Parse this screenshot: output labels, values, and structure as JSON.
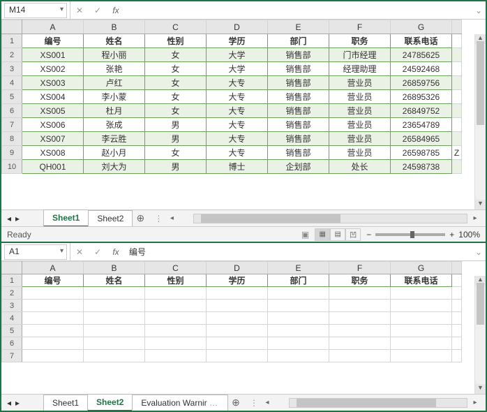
{
  "pane1": {
    "nameBox": "M14",
    "formula": "",
    "columns": [
      "A",
      "B",
      "C",
      "D",
      "E",
      "F",
      "G"
    ],
    "rowNums": [
      "1",
      "2",
      "3",
      "4",
      "5",
      "6",
      "7",
      "8",
      "9",
      "10"
    ],
    "headers": [
      "编号",
      "姓名",
      "性别",
      "学历",
      "部门",
      "职务",
      "联系电话"
    ],
    "rows": [
      [
        "XS001",
        "程小丽",
        "女",
        "大学",
        "销售部",
        "门市经理",
        "24785625",
        ""
      ],
      [
        "XS002",
        "张艳",
        "女",
        "大学",
        "销售部",
        "经理助理",
        "24592468",
        ""
      ],
      [
        "XS003",
        "卢红",
        "女",
        "大专",
        "销售部",
        "营业员",
        "26859756",
        ""
      ],
      [
        "XS004",
        "李小蒙",
        "女",
        "大专",
        "销售部",
        "营业员",
        "26895326",
        ""
      ],
      [
        "XS005",
        "杜月",
        "女",
        "大专",
        "销售部",
        "营业员",
        "26849752",
        ""
      ],
      [
        "XS006",
        "张成",
        "男",
        "大专",
        "销售部",
        "营业员",
        "23654789",
        ""
      ],
      [
        "XS007",
        "李云胜",
        "男",
        "大专",
        "销售部",
        "营业员",
        "26584965",
        ""
      ],
      [
        "XS008",
        "赵小月",
        "女",
        "大专",
        "销售部",
        "营业员",
        "26598785",
        "Z"
      ],
      [
        "QH001",
        "刘大为",
        "男",
        "博士",
        "企划部",
        "处长",
        "24598738",
        ""
      ]
    ],
    "tabs": [
      "Sheet1",
      "Sheet2"
    ],
    "activeTab": "Sheet1"
  },
  "pane2": {
    "nameBox": "A1",
    "formula": "编号",
    "columns": [
      "A",
      "B",
      "C",
      "D",
      "E",
      "F",
      "G"
    ],
    "rowNums": [
      "1",
      "2",
      "3",
      "4",
      "5",
      "6",
      "7"
    ],
    "headers": [
      "编号",
      "姓名",
      "性别",
      "学历",
      "部门",
      "职务",
      "联系电话"
    ],
    "tabs": [
      "Sheet1",
      "Sheet2",
      "Evaluation Warnir"
    ],
    "activeTab": "Sheet2"
  },
  "status": {
    "ready": "Ready",
    "zoom": "100%"
  }
}
